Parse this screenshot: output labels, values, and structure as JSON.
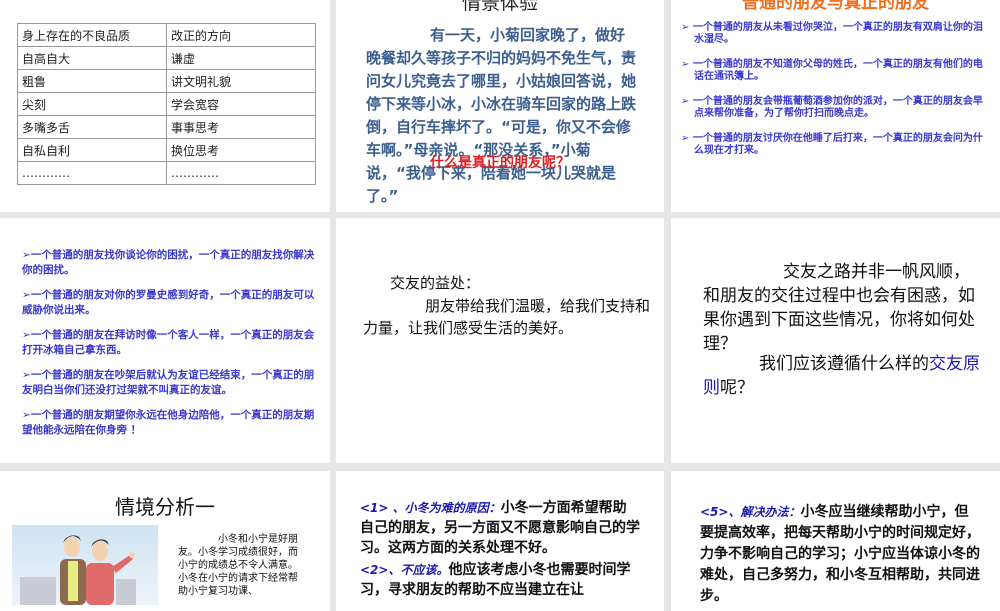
{
  "slides": {
    "s1": {
      "table": {
        "headers": [
          "身上存在的不良品质",
          "改正的方向"
        ],
        "rows": [
          [
            "自高自大",
            "谦虚"
          ],
          [
            "粗鲁",
            "讲文明礼貌"
          ],
          [
            "尖刻",
            "学会宽容"
          ],
          [
            "多嘴多舌",
            "事事思考"
          ],
          [
            "自私自利",
            "换位思考"
          ],
          [
            "…………",
            "…………"
          ]
        ]
      }
    },
    "s2": {
      "title": "情景体验",
      "story": "有一天，小菊回家晚了，做好晚餐却久等孩子不归的妈妈不免生气，责问女儿究竟去了哪里，小姑娘回答说，她停下来等小冰，小冰在骑车回家的路上跌倒，自行车摔坏了。“可是，你又不会修车啊。”母亲说。“那没关系，”小菊说，“我停下来，陪着她一块儿哭就是了。”",
      "question": "什么是真正的朋友呢？"
    },
    "s3": {
      "title": "普通的朋友与真正的朋友",
      "bullets": [
        "一个普通的朋友从未看过你哭泣，一个真正的朋友有双肩让你的泪水湿尽。",
        "一个普通的朋友不知道你父母的姓氏，一个真正的朋友有他们的电话在通讯簿上。",
        "一个普通的朋友会带瓶葡萄酒参加你的派对，一个真正的朋友会早点来帮你准备，为了帮你打扫而晚点走。",
        "一个普通的朋友讨厌你在他睡了后打来，一个真正的朋友会问为什么现在才打来。"
      ]
    },
    "s4": {
      "bullets": [
        "一个普通的朋友找你谈论你的困扰，一个真正的朋友找你解决你的困扰。",
        "一个普通的朋友对你的罗曼史感到好奇，一个真正的朋友可以威胁你说出来。",
        "一个普通的朋友在拜访时像一个客人一样，一个真正的朋友会打开冰箱自己拿东西。",
        "一个普通的朋友在吵架后就认为友谊已经结束，一个真正的朋友明白当你们还没打过架就不叫真正的友谊。",
        "一个普通的朋友期望你永远在他身边陪他，一个真正的朋友期望他能永远陪在你身旁 ！"
      ]
    },
    "s5": {
      "heading": "交友的益处：",
      "body": "朋友带给我们温暖，给我们支持和力量，让我们感受生活的美好。"
    },
    "s6": {
      "para1": "交友之路并非一帆风顺，和朋友的交往过程中也会有困惑，如果你遇到下面这些情况，你将如何处理？",
      "para2_prefix": "我们应该遵循什么样的",
      "para2_highlight": "交友原则",
      "para2_suffix": "呢？",
      "highlight_color": "#1a1ab0"
    },
    "s7": {
      "title": "情境分析一",
      "body": "小冬和小宁是好朋友。小冬学习成绩很好，而小宁的成绩总不令人满意。小冬在小宁的请求下经常帮助小宁复习功课、"
    },
    "s8": {
      "item1_label": "<1> 、小冬为难的原因：",
      "item1_text": "小冬一方面希望帮助自己的朋友，另一方面又不愿意影响自己的学习。这两方面的关系处理不好。",
      "item2_label": "<2>、不应该。",
      "item2_text": "他应该考虑小冬也需要时间学习，寻求朋友的帮助不应当建立在让"
    },
    "s9": {
      "item5_label": "<5>、解决办法：",
      "item5_text": "小冬应当继续帮助小宁，但要提高效率，把每天帮助小宁的时间规定好，力争不影响自己的学习；小宁应当体谅小冬的难处，自己多努力，和小冬互相帮助，共同进步。"
    }
  },
  "colors": {
    "background": "#e6e6e6",
    "story_blue": "#3d5f8f",
    "bullet_blue": "#3a3acc",
    "question_red": "#e02020",
    "title_orange": "#f07020"
  }
}
